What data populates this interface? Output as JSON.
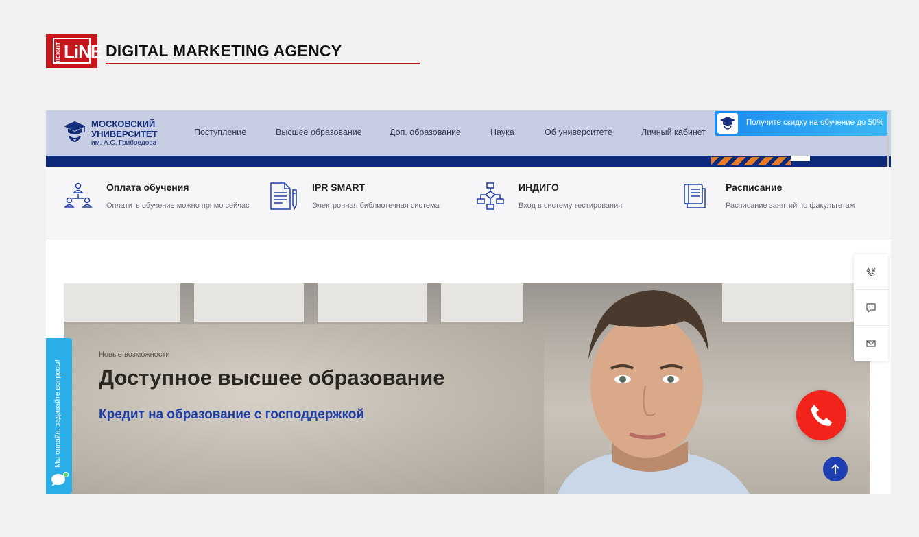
{
  "agency": {
    "logo_small": "HEIGHT",
    "logo_big": "LiNE",
    "title": "DIGITAL MARKETING AGENCY",
    "brand_color": "#c4161c"
  },
  "site": {
    "logo": {
      "line1": "МОСКОВСКИЙ",
      "line2": "УНИВЕРСИТЕТ",
      "sub": "им. А.С. Грибоедова",
      "icon": "graduation-cap-icon"
    },
    "menu": [
      "Поступление",
      "Высшее образование",
      "Доп. образование",
      "Наука",
      "Об университете",
      "Личный кабинет"
    ],
    "promo": {
      "text": "Получите скидку на обучение до 50%",
      "icon": "graduation-cap-icon"
    },
    "services": [
      {
        "title": "Оплата обучения",
        "desc": "Оплатить обучение можно прямо сейчас",
        "icon": "people-network-icon"
      },
      {
        "title": "IPR SMART",
        "desc": "Электронная библиотечная система",
        "icon": "document-pencil-icon"
      },
      {
        "title": "ИНДИГО",
        "desc": "Вход в систему тестирования",
        "icon": "flowchart-icon"
      },
      {
        "title": "Расписание",
        "desc": "Расписание занятий по факультетам",
        "icon": "schedule-list-icon"
      }
    ],
    "hero": {
      "kicker": "Новые возможности",
      "title": "Доступное высшее образование",
      "subtitle": "Кредит на образование с господдержкой"
    },
    "side_widgets": [
      "phone-callback-icon",
      "chat-icon",
      "mail-icon"
    ],
    "chat_widget": {
      "text": "Мы онлайн, задавайте вопросы!",
      "icon": "chat-bubbles-icon"
    },
    "colors": {
      "nav_bg": "#c7cde2",
      "nav_bar": "#0d2a7a",
      "accent_blue": "#1e3ea8",
      "call_red": "#f2231a",
      "chat_blue": "#2aaee8"
    }
  }
}
